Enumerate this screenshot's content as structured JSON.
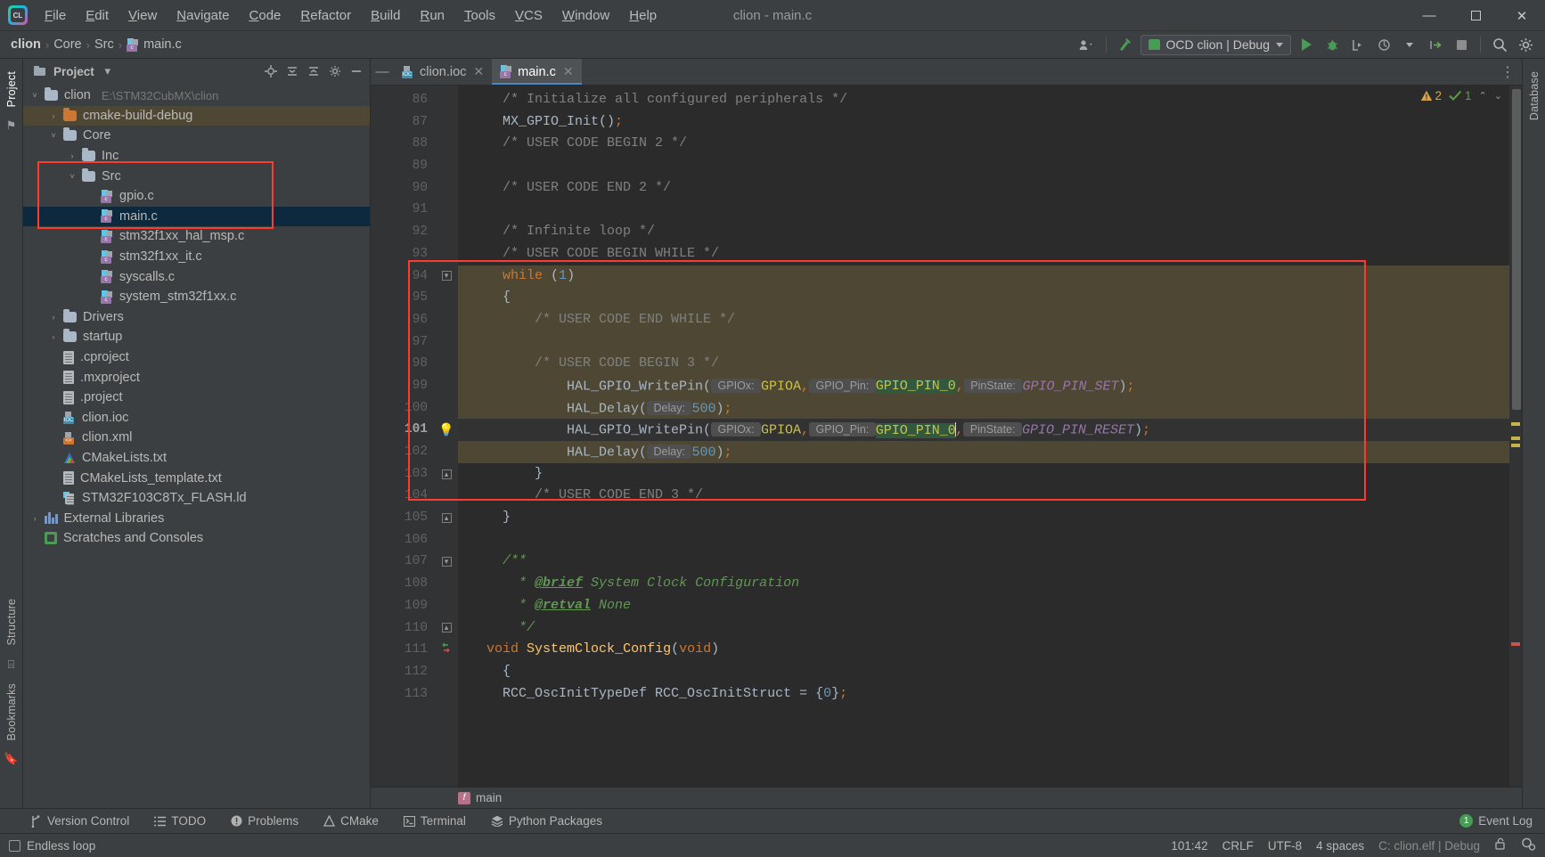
{
  "window": {
    "title": "clion - main.c",
    "minimize": "—",
    "maximize": "☐",
    "close": "✕"
  },
  "menu": [
    {
      "label": "File"
    },
    {
      "label": "Edit"
    },
    {
      "label": "View"
    },
    {
      "label": "Navigate"
    },
    {
      "label": "Code"
    },
    {
      "label": "Refactor"
    },
    {
      "label": "Build"
    },
    {
      "label": "Run"
    },
    {
      "label": "Tools"
    },
    {
      "label": "VCS"
    },
    {
      "label": "Window"
    },
    {
      "label": "Help"
    }
  ],
  "breadcrumb": {
    "items": [
      "clion",
      "Core",
      "Src",
      "main.c"
    ],
    "separator": "›"
  },
  "toolbar": {
    "run_config": "OCD clion | Debug",
    "search_icon": "search-icon",
    "settings_icon": "gear-icon",
    "build_icon": "hammer-icon",
    "user_icon": "user-icon"
  },
  "project_panel": {
    "title": "Project",
    "dropdown_caret": "▾",
    "actions": [
      "target-icon",
      "collapse-icon",
      "expand-icon",
      "settings-icon",
      "hide-icon"
    ],
    "tree": [
      {
        "label": "clion",
        "path": "E:\\STM32CubMX\\clion",
        "type": "folder",
        "depth": 0,
        "arrow": "˅",
        "state": "normal"
      },
      {
        "label": "cmake-build-debug",
        "type": "folder-orange",
        "depth": 1,
        "arrow": "›",
        "state": "highlight"
      },
      {
        "label": "Core",
        "type": "folder",
        "depth": 1,
        "arrow": "˅",
        "state": "normal"
      },
      {
        "label": "Inc",
        "type": "folder",
        "depth": 2,
        "arrow": "›",
        "state": "normal"
      },
      {
        "label": "Src",
        "type": "folder",
        "depth": 2,
        "arrow": "˅",
        "state": "normal"
      },
      {
        "label": "gpio.c",
        "type": "c-file",
        "depth": 3,
        "arrow": "",
        "state": "normal"
      },
      {
        "label": "main.c",
        "type": "c-file",
        "depth": 3,
        "arrow": "",
        "state": "selected"
      },
      {
        "label": "stm32f1xx_hal_msp.c",
        "type": "c-file",
        "depth": 3,
        "arrow": "",
        "state": "normal"
      },
      {
        "label": "stm32f1xx_it.c",
        "type": "c-file",
        "depth": 3,
        "arrow": "",
        "state": "normal"
      },
      {
        "label": "syscalls.c",
        "type": "c-file",
        "depth": 3,
        "arrow": "",
        "state": "normal"
      },
      {
        "label": "system_stm32f1xx.c",
        "type": "c-file",
        "depth": 3,
        "arrow": "",
        "state": "normal"
      },
      {
        "label": "Drivers",
        "type": "folder",
        "depth": 1,
        "arrow": "›",
        "state": "normal"
      },
      {
        "label": "startup",
        "type": "folder",
        "depth": 1,
        "arrow": "›",
        "state": "normal"
      },
      {
        "label": ".cproject",
        "type": "doc",
        "depth": 1,
        "arrow": "",
        "state": "normal"
      },
      {
        "label": ".mxproject",
        "type": "doc",
        "depth": 1,
        "arrow": "",
        "state": "normal"
      },
      {
        "label": ".project",
        "type": "doc",
        "depth": 1,
        "arrow": "",
        "state": "normal"
      },
      {
        "label": "clion.ioc",
        "type": "ioc-file",
        "depth": 1,
        "arrow": "",
        "state": "normal"
      },
      {
        "label": "clion.xml",
        "type": "xml-file",
        "depth": 1,
        "arrow": "",
        "state": "normal"
      },
      {
        "label": "CMakeLists.txt",
        "type": "cmake",
        "depth": 1,
        "arrow": "",
        "state": "normal"
      },
      {
        "label": "CMakeLists_template.txt",
        "type": "doc",
        "depth": 1,
        "arrow": "",
        "state": "normal"
      },
      {
        "label": "STM32F103C8Tx_FLASH.ld",
        "type": "doc-blue",
        "depth": 1,
        "arrow": "",
        "state": "normal"
      },
      {
        "label": "External Libraries",
        "type": "library",
        "depth": 0,
        "arrow": "›",
        "state": "normal"
      },
      {
        "label": "Scratches and Consoles",
        "type": "scratch",
        "depth": 0,
        "arrow": "",
        "state": "normal"
      }
    ]
  },
  "left_strip": {
    "project_label": "Project",
    "structure_label": "Structure",
    "bookmarks_label": "Bookmarks"
  },
  "right_strip": {
    "database_label": "Database"
  },
  "tabs": [
    {
      "label": "clion.ioc",
      "icon": "ioc-file-icon",
      "active": false,
      "close": "✕"
    },
    {
      "label": "main.c",
      "icon": "c-file-icon",
      "active": true,
      "close": "✕"
    }
  ],
  "inspections": {
    "warnings": "2",
    "checks": "1",
    "warning_icon": "warning-triangle-icon",
    "ok_icon": "check-icon",
    "up_chevron": "⌃",
    "down_chevron": "⌄"
  },
  "editor": {
    "first_line": 86,
    "current_line": 101,
    "lines": [
      {
        "n": 86,
        "indent": 2,
        "tokens": [
          {
            "t": "/* Initialize all configured peripherals */",
            "c": "c-comment"
          }
        ]
      },
      {
        "n": 87,
        "indent": 2,
        "tokens": [
          {
            "t": "MX_GPIO_Init()",
            "c": "c-txt"
          },
          {
            "t": ";",
            "c": "c-semi"
          }
        ]
      },
      {
        "n": 88,
        "indent": 2,
        "tokens": [
          {
            "t": "/* USER CODE BEGIN 2 */",
            "c": "c-comment"
          }
        ]
      },
      {
        "n": 89,
        "indent": 0,
        "tokens": []
      },
      {
        "n": 90,
        "indent": 2,
        "tokens": [
          {
            "t": "/* USER CODE END 2 */",
            "c": "c-comment"
          }
        ]
      },
      {
        "n": 91,
        "indent": 0,
        "tokens": []
      },
      {
        "n": 92,
        "indent": 2,
        "tokens": [
          {
            "t": "/* Infinite loop */",
            "c": "c-comment"
          }
        ]
      },
      {
        "n": 93,
        "indent": 2,
        "tokens": [
          {
            "t": "/* USER CODE BEGIN WHILE */",
            "c": "c-comment"
          }
        ]
      },
      {
        "n": 94,
        "indent": 2,
        "hl": true,
        "fold": "open",
        "tokens": [
          {
            "t": "while",
            "c": "c-kw"
          },
          {
            "t": " (",
            "c": "c-txt"
          },
          {
            "t": "1",
            "c": "c-num"
          },
          {
            "t": ")",
            "c": "c-txt"
          }
        ]
      },
      {
        "n": 95,
        "indent": 2,
        "hl": true,
        "tokens": [
          {
            "t": "{",
            "c": "c-txt"
          }
        ]
      },
      {
        "n": 96,
        "indent": 4,
        "hl": true,
        "tokens": [
          {
            "t": "/* USER CODE END WHILE */",
            "c": "c-comment"
          }
        ]
      },
      {
        "n": 97,
        "indent": 0,
        "hl": true,
        "tokens": []
      },
      {
        "n": 98,
        "indent": 4,
        "hl": true,
        "tokens": [
          {
            "t": "/* USER CODE BEGIN 3 */",
            "c": "c-comment"
          }
        ]
      },
      {
        "n": 99,
        "indent": 6,
        "hl": true,
        "tokens": [
          {
            "t": "HAL_GPIO_WritePin(",
            "c": "c-txt"
          },
          {
            "t": " GPIOx: ",
            "c": "hint"
          },
          {
            "t": "GPIOA",
            "c": "c-const"
          },
          {
            "t": ",",
            "c": "c-semi"
          },
          {
            "t": " GPIO_Pin: ",
            "c": "hint"
          },
          {
            "t": "GPIO_PIN_0",
            "c": "c-const usage-hl"
          },
          {
            "t": ",",
            "c": "c-semi"
          },
          {
            "t": " PinState: ",
            "c": "hint"
          },
          {
            "t": "GPIO_PIN_SET",
            "c": "c-macro"
          },
          {
            "t": ")",
            "c": "c-txt"
          },
          {
            "t": ";",
            "c": "c-semi"
          }
        ]
      },
      {
        "n": 100,
        "indent": 6,
        "hl": true,
        "tokens": [
          {
            "t": "HAL_Delay(",
            "c": "c-txt"
          },
          {
            "t": " Delay: ",
            "c": "hint"
          },
          {
            "t": "500",
            "c": "c-num"
          },
          {
            "t": ")",
            "c": "c-txt"
          },
          {
            "t": ";",
            "c": "c-semi"
          }
        ]
      },
      {
        "n": 101,
        "indent": 6,
        "hl": true,
        "bulb": true,
        "current": true,
        "tokens": [
          {
            "t": "HAL_GPIO_WritePin(",
            "c": "c-txt"
          },
          {
            "t": " GPIOx: ",
            "c": "hint"
          },
          {
            "t": "GPIOA",
            "c": "c-const"
          },
          {
            "t": ",",
            "c": "c-semi"
          },
          {
            "t": " GPIO_Pin: ",
            "c": "hint"
          },
          {
            "t": "GPIO_PIN_0",
            "c": "c-const usage-hl"
          },
          {
            "t": "|caret|",
            "c": "caret"
          },
          {
            "t": ",",
            "c": "c-semi"
          },
          {
            "t": " PinState: ",
            "c": "hint"
          },
          {
            "t": "GPIO_PIN_RESET",
            "c": "c-macro"
          },
          {
            "t": ")",
            "c": "c-txt"
          },
          {
            "t": ";",
            "c": "c-semi"
          }
        ]
      },
      {
        "n": 102,
        "indent": 6,
        "hl": true,
        "tokens": [
          {
            "t": "HAL_Delay(",
            "c": "c-txt"
          },
          {
            "t": " Delay: ",
            "c": "hint"
          },
          {
            "t": "500",
            "c": "c-num"
          },
          {
            "t": ")",
            "c": "c-txt"
          },
          {
            "t": ";",
            "c": "c-semi"
          }
        ]
      },
      {
        "n": 103,
        "indent": 4,
        "hlpart": true,
        "fold": "close",
        "tokens": [
          {
            "t": "}",
            "c": "c-txt"
          }
        ]
      },
      {
        "n": 104,
        "indent": 4,
        "tokens": [
          {
            "t": "/* USER CODE END 3 */",
            "c": "c-comment"
          }
        ]
      },
      {
        "n": 105,
        "indent": 2,
        "fold": "close",
        "tokens": [
          {
            "t": "}",
            "c": "c-txt"
          }
        ]
      },
      {
        "n": 106,
        "indent": 0,
        "tokens": []
      },
      {
        "n": 107,
        "indent": 2,
        "fold": "open",
        "tokens": [
          {
            "t": "/**",
            "c": "c-docs"
          }
        ]
      },
      {
        "n": 108,
        "indent": 3,
        "tokens": [
          {
            "t": "* ",
            "c": "c-docs"
          },
          {
            "t": "@brief",
            "c": "c-doctag"
          },
          {
            "t": " System Clock Configuration",
            "c": "c-docs"
          }
        ]
      },
      {
        "n": 109,
        "indent": 3,
        "tokens": [
          {
            "t": "* ",
            "c": "c-docs"
          },
          {
            "t": "@retval",
            "c": "c-doctag"
          },
          {
            "t": " None",
            "c": "c-docs"
          }
        ]
      },
      {
        "n": 110,
        "indent": 3,
        "fold": "close",
        "tokens": [
          {
            "t": "*/",
            "c": "c-docs"
          }
        ]
      },
      {
        "n": 111,
        "indent": 1,
        "impl": true,
        "fold": "open",
        "tokens": [
          {
            "t": "void",
            "c": "c-kw"
          },
          {
            "t": " ",
            "c": "c-txt"
          },
          {
            "t": "SystemClock_Config",
            "c": "c-fn"
          },
          {
            "t": "(",
            "c": "c-txt"
          },
          {
            "t": "void",
            "c": "c-kw"
          },
          {
            "t": ")",
            "c": "c-txt"
          }
        ]
      },
      {
        "n": 112,
        "indent": 2,
        "tokens": [
          {
            "t": "{",
            "c": "c-txt"
          }
        ]
      },
      {
        "n": 113,
        "indent": 2,
        "tokens": [
          {
            "t": "RCC_OscInitTypeDef RCC_OscInitStruct = {",
            "c": "c-txt"
          },
          {
            "t": "0",
            "c": "c-num"
          },
          {
            "t": "}",
            "c": "c-txt"
          },
          {
            "t": ";",
            "c": "c-semi"
          }
        ]
      }
    ],
    "breadcrumb_fn": "main",
    "breadcrumb_badge": "f"
  },
  "tool_window_bar": [
    {
      "label": "Version Control",
      "icon": "branch-icon"
    },
    {
      "label": "TODO",
      "icon": "list-icon"
    },
    {
      "label": "Problems",
      "icon": "error-icon"
    },
    {
      "label": "CMake",
      "icon": "cmake-icon"
    },
    {
      "label": "Terminal",
      "icon": "terminal-icon"
    },
    {
      "label": "Python Packages",
      "icon": "layers-icon"
    }
  ],
  "event_log": {
    "label": "Event Log",
    "count": "1"
  },
  "status_bar": {
    "message": "Endless loop",
    "message_icon": "document-icon",
    "caret_position": "101:42",
    "line_separator": "CRLF",
    "encoding": "UTF-8",
    "indent": "4 spaces",
    "target": "C: clion.elf | Debug",
    "lock_icon": "unlocked-icon",
    "inspector_icon": "inspector-icon"
  },
  "colors": {
    "accent_blue": "#4a88c7",
    "selection": "#0d293e",
    "highlight_block": "#4e4733",
    "annotation_red": "#ff3b30",
    "green": "#499c54",
    "warning": "#d9a343"
  }
}
